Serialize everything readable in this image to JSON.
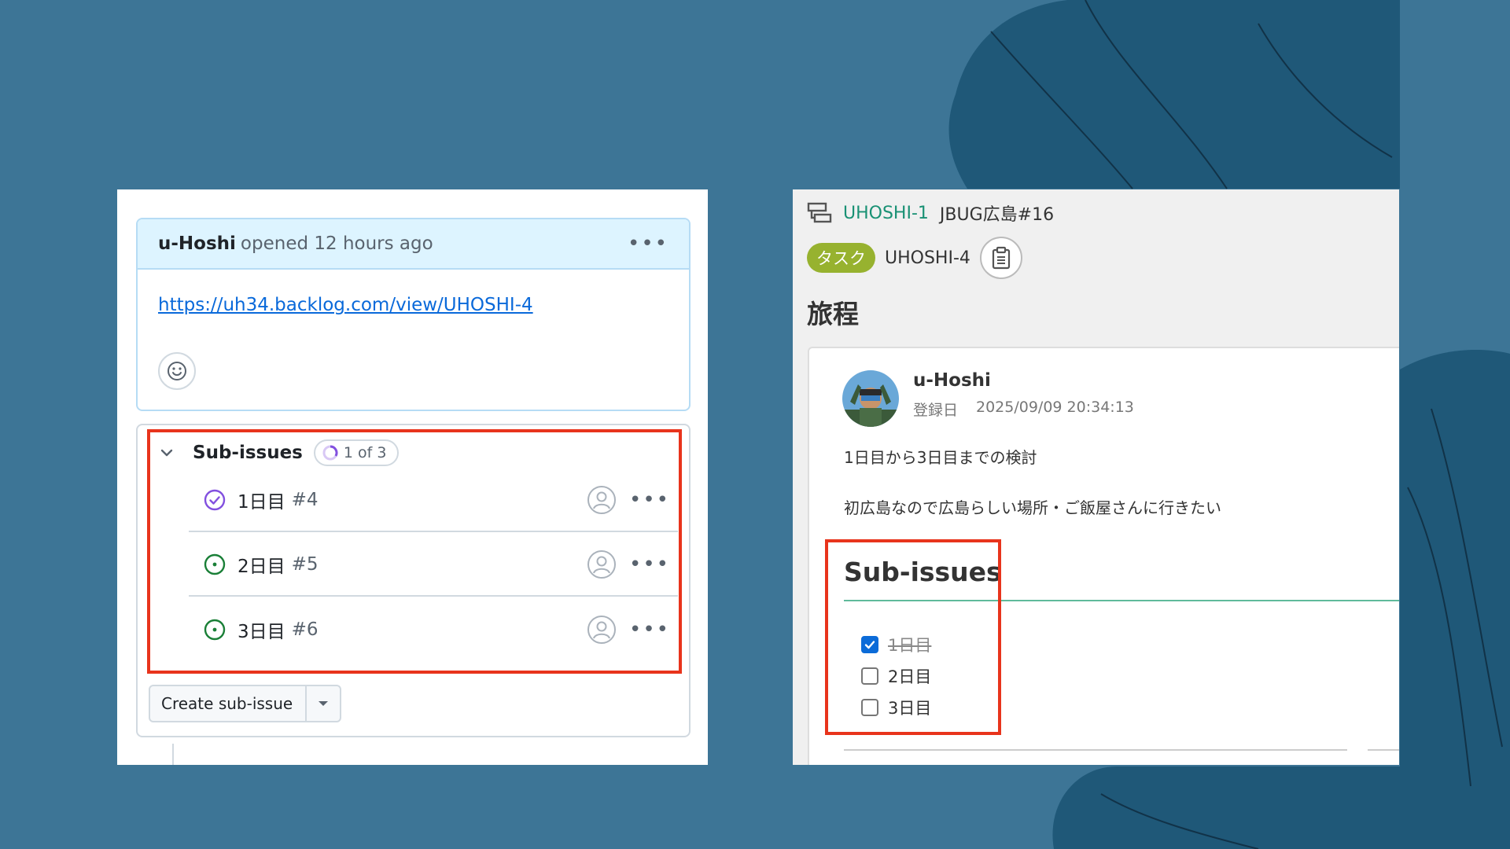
{
  "colors": {
    "background": "#3d7596",
    "highlight_border": "#e8341c",
    "github_link": "#0969da",
    "github_done": "#8250df",
    "github_open": "#1a7f37",
    "backlog_key": "#199174",
    "backlog_tag": "#97b22f"
  },
  "github": {
    "comment": {
      "author": "u-Hoshi",
      "opened_text": "opened 12 hours ago",
      "more_icon": "•••",
      "link": "https://uh34.backlog.com/view/UHOSHI-4",
      "reaction_icon": "smiley-icon"
    },
    "sub_issues": {
      "title": "Sub-issues",
      "progress_text": "1 of 3",
      "progress": {
        "completed": 1,
        "total": 3
      },
      "items": [
        {
          "label": "1日目",
          "number": "#4",
          "status": "closed"
        },
        {
          "label": "2日目",
          "number": "#5",
          "status": "open"
        },
        {
          "label": "3日目",
          "number": "#6",
          "status": "open"
        }
      ],
      "row_more_icon": "•••",
      "create_button": "Create sub-issue"
    }
  },
  "backlog": {
    "parent_key": "UHOSHI-1",
    "project_name": "JBUG広島#16",
    "type_tag": "タスク",
    "issue_key": "UHOSHI-4",
    "title": "旅程",
    "author": "u-Hoshi",
    "date_label": "登録日",
    "date": "2025/09/09 20:34:13",
    "description_line1": "1日目から3日目までの検討",
    "description_line2": "初広島なので広島らしい場所・ご飯屋さんに行きたい",
    "sub_issues_title": "Sub-issues",
    "checklist": [
      {
        "label": "1日目",
        "checked": true
      },
      {
        "label": "2日目",
        "checked": false
      },
      {
        "label": "3日目",
        "checked": false
      }
    ]
  }
}
